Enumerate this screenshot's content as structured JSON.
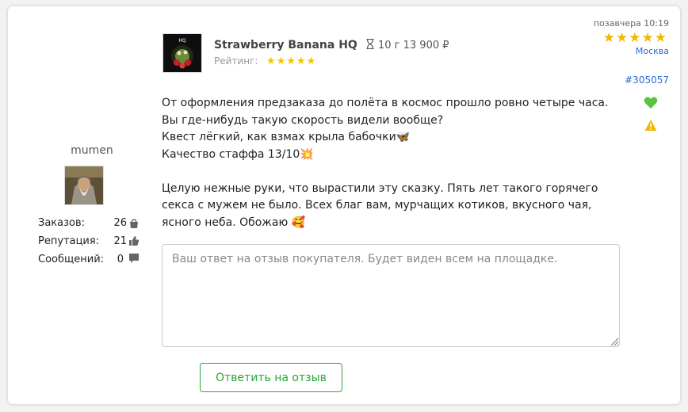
{
  "user": {
    "name": "mumen",
    "stats": [
      {
        "label": "Заказов:",
        "value": "26",
        "icon": "bag-icon"
      },
      {
        "label": "Репутация:",
        "value": "21",
        "icon": "thumbs-up-icon"
      },
      {
        "label": "Сообщений:",
        "value": "0",
        "icon": "chat-icon"
      }
    ]
  },
  "product": {
    "name": "Strawberry Banana HQ",
    "weight": "10 г 13 900 ₽",
    "rating_label": "Рейтинг:",
    "rating_stars": 5
  },
  "meta": {
    "date": "позавчера 10:19",
    "stars": 5,
    "city": "Москва",
    "order_id": "#305057"
  },
  "review": {
    "lines": [
      "От оформления предзаказа до полёта в космос прошло ровно четыре часа.",
      "Вы где-нибудь такую скорость видели вообще?",
      "Квест лёгкий, как взмах крыла бабочки🦋",
      "Качество стаффа 13/10💥",
      "Целую нежные руки, что вырастили эту сказку. Пять лет такого горячего секса с мужем не было. Всех благ вам, мурчащих котиков, вкусного чая, ясного неба. Обожаю 🥰"
    ]
  },
  "reply": {
    "placeholder": "Ваш ответ на отзыв покупателя. Будет виден всем на площадке.",
    "button_label": "Ответить на отзыв"
  },
  "colors": {
    "accent_green": "#2aa838",
    "star_yellow": "#f2b800",
    "link_blue": "#2a6ad3"
  }
}
